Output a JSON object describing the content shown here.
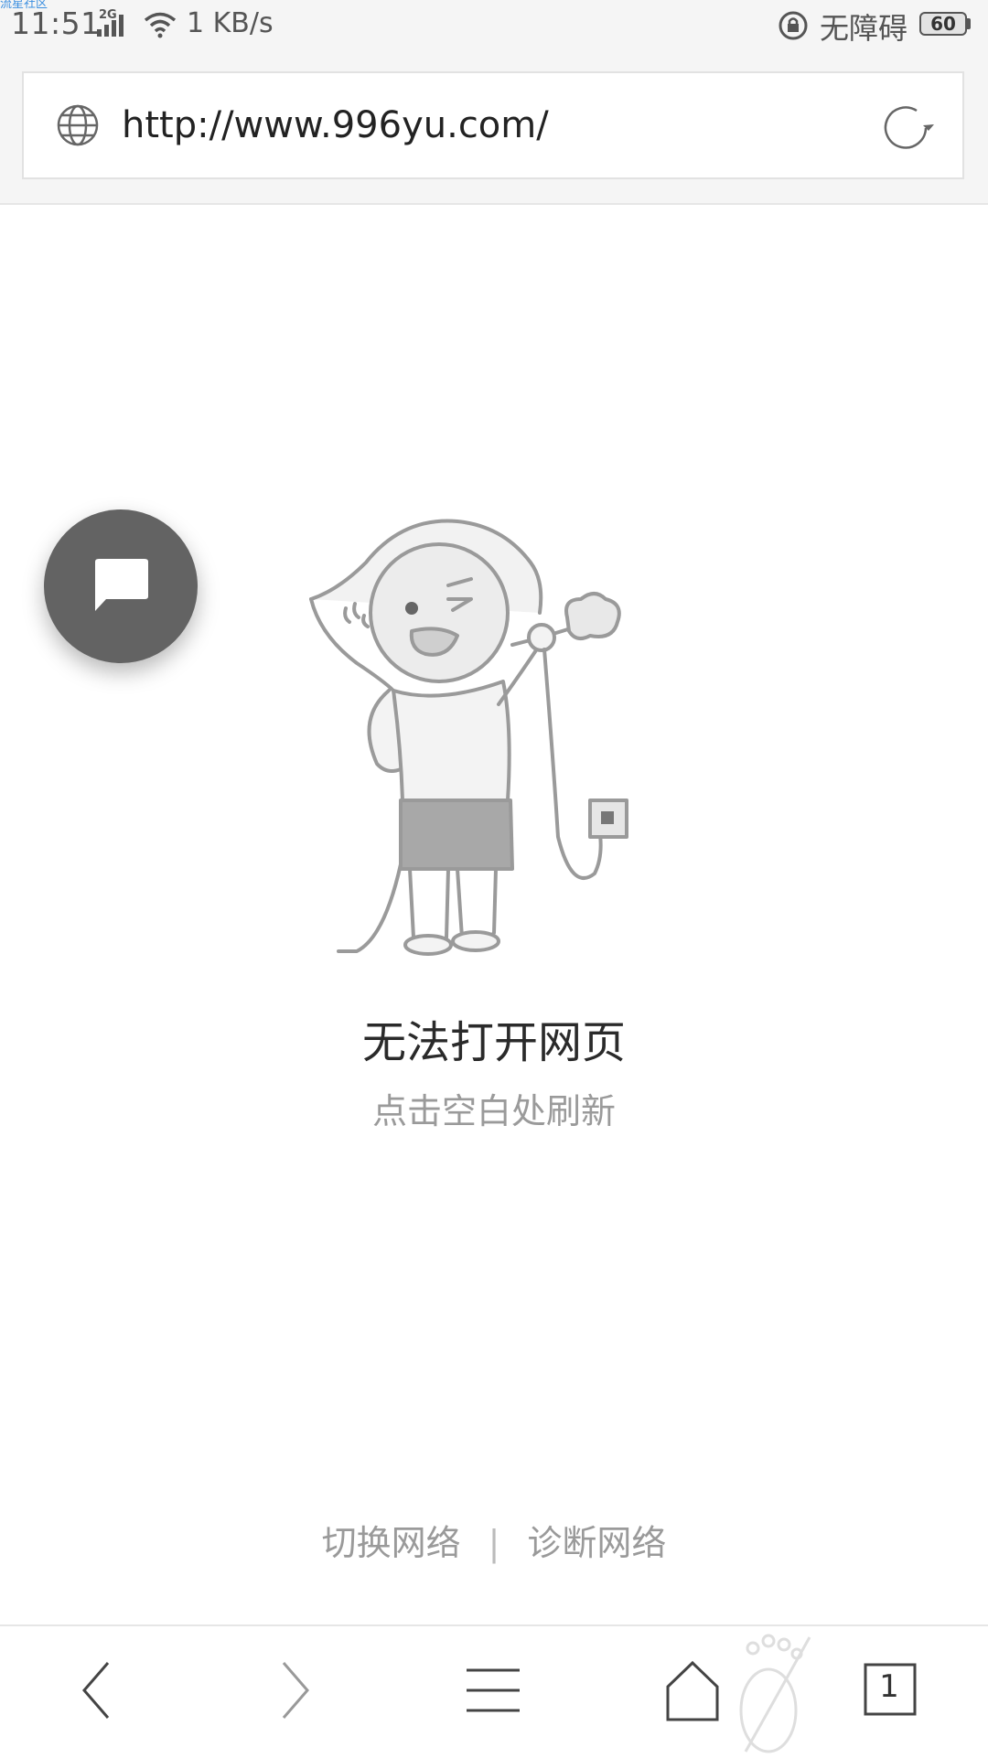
{
  "status_bar": {
    "watermark": "流星社区",
    "time": "11:51",
    "network_type": "2G",
    "speed": "1 KB/s",
    "accessibility_label": "无障碍",
    "battery": "60"
  },
  "address_bar": {
    "url": "http://www.996yu.com/",
    "globe_icon": "globe-icon",
    "reload_icon": "reload-icon"
  },
  "error": {
    "title": "无法打开网页",
    "subtitle": "点击空白处刷新"
  },
  "network_links": {
    "switch_network": "切换网络",
    "separator": "|",
    "diagnose_network": "诊断网络"
  },
  "bottom_nav": {
    "tab_count": "1",
    "icons": [
      "back-icon",
      "forward-icon",
      "menu-icon",
      "home-icon",
      "tabs-icon"
    ]
  },
  "colors": {
    "fab": "#636363",
    "bar_background": "#f5f5f5",
    "muted_text": "#9a9a9a"
  }
}
